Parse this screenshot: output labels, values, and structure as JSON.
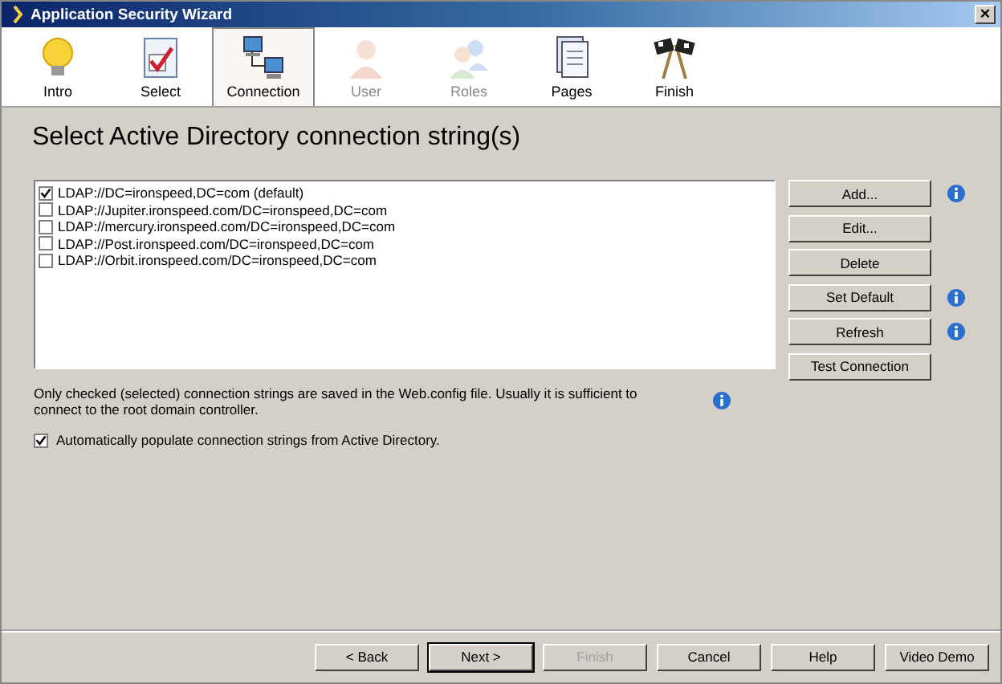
{
  "window": {
    "title": "Application Security Wizard",
    "close": "×"
  },
  "steps": [
    {
      "label": "Intro",
      "kind": "bulb",
      "selected": false,
      "disabled": false
    },
    {
      "label": "Select",
      "kind": "check",
      "selected": false,
      "disabled": false
    },
    {
      "label": "Connection",
      "kind": "network",
      "selected": true,
      "disabled": false
    },
    {
      "label": "User",
      "kind": "user",
      "selected": false,
      "disabled": true
    },
    {
      "label": "Roles",
      "kind": "group",
      "selected": false,
      "disabled": true
    },
    {
      "label": "Pages",
      "kind": "pages",
      "selected": false,
      "disabled": false
    },
    {
      "label": "Finish",
      "kind": "flags",
      "selected": false,
      "disabled": false
    }
  ],
  "heading": "Select Active Directory connection string(s)",
  "connections": [
    {
      "label": "LDAP://DC=ironspeed,DC=com (default)",
      "checked": true
    },
    {
      "label": "LDAP://Jupiter.ironspeed.com/DC=ironspeed,DC=com",
      "checked": false
    },
    {
      "label": "LDAP://mercury.ironspeed.com/DC=ironspeed,DC=com",
      "checked": false
    },
    {
      "label": "LDAP://Post.ironspeed.com/DC=ironspeed,DC=com",
      "checked": false
    },
    {
      "label": "LDAP://Orbit.ironspeed.com/DC=ironspeed,DC=com",
      "checked": false
    }
  ],
  "side_buttons": [
    {
      "label": "Add...",
      "info": true
    },
    {
      "label": "Edit...",
      "info": false
    },
    {
      "label": "Delete",
      "info": false
    },
    {
      "label": "Set Default",
      "info": true
    },
    {
      "label": "Refresh",
      "info": true
    },
    {
      "label": "Test Connection",
      "info": false
    }
  ],
  "note": "Only checked (selected) connection strings are saved in the Web.config file. Usually it is sufficient to connect to the root domain controller.",
  "auto_populate": {
    "label": "Automatically populate connection strings from Active Directory.",
    "checked": true
  },
  "footer_buttons": [
    {
      "label": "< Back",
      "disabled": false,
      "default": false
    },
    {
      "label": "Next >",
      "disabled": false,
      "default": true
    },
    {
      "label": "Finish",
      "disabled": true,
      "default": false
    },
    {
      "label": "Cancel",
      "disabled": false,
      "default": false
    },
    {
      "label": "Help",
      "disabled": false,
      "default": false
    },
    {
      "label": "Video Demo",
      "disabled": false,
      "default": false
    }
  ]
}
